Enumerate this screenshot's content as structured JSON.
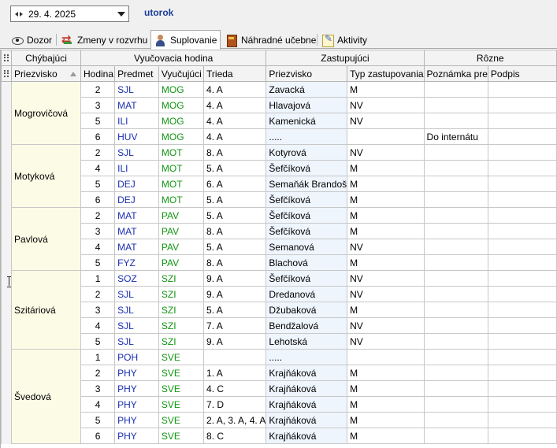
{
  "toolbar": {
    "date": "29. 4. 2025",
    "day": "utorok"
  },
  "tabs": [
    {
      "label": "Dozor",
      "icon": "eye-icon",
      "active": false
    },
    {
      "label": "Zmeny v rozvrhu",
      "icon": "swap-icon",
      "active": false
    },
    {
      "label": "Suplovanie",
      "icon": "person-icon",
      "active": true
    },
    {
      "label": "Náhradné učebne",
      "icon": "book-icon",
      "active": false
    },
    {
      "label": "Aktivity",
      "icon": "note-icon",
      "active": false
    }
  ],
  "groups": {
    "absent": "Chýbajúci",
    "lesson": "Vyučovacia hodina",
    "substitute": "Zastupujúci",
    "misc": "Rôzne"
  },
  "columns": {
    "surname": "Priezvisko",
    "hour": "Hodina",
    "subject": "Predmet",
    "teacher": "Vyučujúci",
    "class": "Trieda",
    "sub_surname": "Priezvisko",
    "sub_type": "Typ zastupovania",
    "note": "Poznámka pre",
    "sign": "Podpis"
  },
  "rows": [
    {
      "group": "Mogrovičová",
      "hour": "2",
      "subject": "SJL",
      "teacher": "MOG",
      "class": "4. A",
      "sub": "Zavacká",
      "type": "M",
      "note": ""
    },
    {
      "group": "Mogrovičová",
      "hour": "3",
      "subject": "MAT",
      "teacher": "MOG",
      "class": "4. A",
      "sub": "Hlavajová",
      "type": "NV",
      "note": ""
    },
    {
      "group": "Mogrovičová",
      "hour": "5",
      "subject": "ILI",
      "teacher": "MOG",
      "class": "4. A",
      "sub": "Kamenická",
      "type": "NV",
      "note": ""
    },
    {
      "group": "Mogrovičová",
      "hour": "6",
      "subject": "HUV",
      "teacher": "MOG",
      "class": "4. A",
      "sub": ".....",
      "type": "",
      "note": "Do internátu"
    },
    {
      "group": "Motyková",
      "hour": "2",
      "subject": "SJL",
      "teacher": "MOT",
      "class": "8. A",
      "sub": "Kotyrová",
      "type": "NV",
      "note": ""
    },
    {
      "group": "Motyková",
      "hour": "4",
      "subject": "ILI",
      "teacher": "MOT",
      "class": "5. A",
      "sub": "Šefčíková",
      "type": "M",
      "note": ""
    },
    {
      "group": "Motyková",
      "hour": "5",
      "subject": "DEJ",
      "teacher": "MOT",
      "class": "6. A",
      "sub": "Semaňák Brandoš",
      "type": "M",
      "note": ""
    },
    {
      "group": "Motyková",
      "hour": "6",
      "subject": "DEJ",
      "teacher": "MOT",
      "class": "5. A",
      "sub": "Šefčíková",
      "type": "M",
      "note": ""
    },
    {
      "group": "Pavlová",
      "hour": "2",
      "subject": "MAT",
      "teacher": "PAV",
      "class": "5. A",
      "sub": "Šefčíková",
      "type": "M",
      "note": ""
    },
    {
      "group": "Pavlová",
      "hour": "3",
      "subject": "MAT",
      "teacher": "PAV",
      "class": "8. A",
      "sub": "Šefčíková",
      "type": "M",
      "note": ""
    },
    {
      "group": "Pavlová",
      "hour": "4",
      "subject": "MAT",
      "teacher": "PAV",
      "class": "5. A",
      "sub": "Semanová",
      "type": "NV",
      "note": ""
    },
    {
      "group": "Pavlová",
      "hour": "5",
      "subject": "FYZ",
      "teacher": "PAV",
      "class": "8. A",
      "sub": "Blachová",
      "type": "M",
      "note": ""
    },
    {
      "group": "Szitáriová",
      "hour": "1",
      "subject": "SOZ",
      "teacher": "SZI",
      "class": "9. A",
      "sub": "Šefčíková",
      "type": "NV",
      "note": ""
    },
    {
      "group": "Szitáriová",
      "hour": "2",
      "subject": "SJL",
      "teacher": "SZI",
      "class": "9. A",
      "sub": "Dredanová",
      "type": "NV",
      "note": ""
    },
    {
      "group": "Szitáriová",
      "hour": "3",
      "subject": "SJL",
      "teacher": "SZI",
      "class": "5. A",
      "sub": "Džubaková",
      "type": "M",
      "note": ""
    },
    {
      "group": "Szitáriová",
      "hour": "4",
      "subject": "SJL",
      "teacher": "SZI",
      "class": "7. A",
      "sub": "Bendžalová",
      "type": "NV",
      "note": ""
    },
    {
      "group": "Szitáriová",
      "hour": "5",
      "subject": "SJL",
      "teacher": "SZI",
      "class": "9. A",
      "sub": "Lehotská",
      "type": "NV",
      "note": ""
    },
    {
      "group": "Švedová",
      "hour": "1",
      "subject": "POH",
      "teacher": "SVE",
      "class": "",
      "sub": ".....",
      "type": "",
      "note": ""
    },
    {
      "group": "Švedová",
      "hour": "2",
      "subject": "PHY",
      "teacher": "SVE",
      "class": "1. A",
      "sub": "Krajňáková",
      "type": "M",
      "note": ""
    },
    {
      "group": "Švedová",
      "hour": "3",
      "subject": "PHY",
      "teacher": "SVE",
      "class": "4. C",
      "sub": "Krajňáková",
      "type": "M",
      "note": ""
    },
    {
      "group": "Švedová",
      "hour": "4",
      "subject": "PHY",
      "teacher": "SVE",
      "class": "7. D",
      "sub": "Krajňáková",
      "type": "M",
      "note": ""
    },
    {
      "group": "Švedová",
      "hour": "5",
      "subject": "PHY",
      "teacher": "SVE",
      "class": "2. A, 3. A, 4. A",
      "sub": "Krajňáková",
      "type": "M",
      "note": ""
    },
    {
      "group": "Švedová",
      "hour": "6",
      "subject": "PHY",
      "teacher": "SVE",
      "class": "8. C",
      "sub": "Krajňáková",
      "type": "M",
      "note": ""
    }
  ]
}
